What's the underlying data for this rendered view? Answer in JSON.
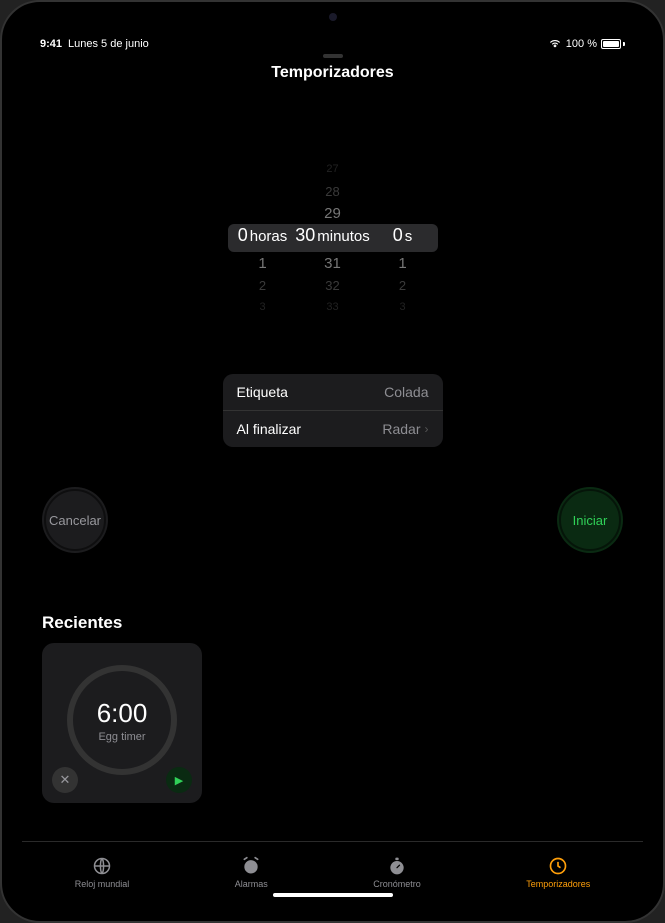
{
  "status": {
    "time": "9:41",
    "date": "Lunes 5 de junio",
    "battery_pct": "100 %"
  },
  "header": {
    "title": "Temporizadores"
  },
  "picker": {
    "hours": {
      "selected": "0",
      "unit": "horas",
      "options_above": [],
      "options_below": [
        "1",
        "2",
        "3"
      ]
    },
    "minutes": {
      "selected": "30",
      "unit": "minutos",
      "options_above": [
        "27",
        "28",
        "29"
      ],
      "options_below": [
        "31",
        "32",
        "33"
      ]
    },
    "seconds": {
      "selected": "0",
      "unit": "s",
      "options_above": [],
      "options_below": [
        "1",
        "2",
        "3"
      ]
    }
  },
  "settings": {
    "label_title": "Etiqueta",
    "label_value": "Colada",
    "end_title": "Al finalizar",
    "end_value": "Radar"
  },
  "actions": {
    "cancel": "Cancelar",
    "start": "Iniciar"
  },
  "recents": {
    "title": "Recientes",
    "items": [
      {
        "time": "6:00",
        "label": "Egg timer"
      }
    ]
  },
  "tabs": {
    "world": "Reloj mundial",
    "alarms": "Alarmas",
    "stopwatch": "Cronómetro",
    "timers": "Temporizadores"
  }
}
